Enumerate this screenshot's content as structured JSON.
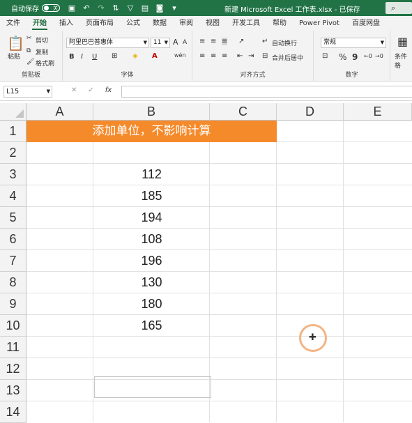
{
  "titlebar": {
    "autosave_label": "自动保存",
    "autosave_state": "关",
    "title": "新建 Microsoft Excel 工作表.xlsx - 已保存",
    "search_icon": "search-icon"
  },
  "menu": {
    "tabs": [
      "文件",
      "开始",
      "插入",
      "页面布局",
      "公式",
      "数据",
      "审阅",
      "视图",
      "开发工具",
      "帮助",
      "Power Pivot",
      "百度网盘"
    ],
    "active": "开始"
  },
  "ribbon": {
    "clipboard": {
      "paste": "粘贴",
      "cut": "剪切",
      "copy": "复制",
      "format_painter": "格式刷",
      "label": "剪贴板"
    },
    "font": {
      "name": "阿里巴巴普惠体",
      "size": "11",
      "bold": "B",
      "italic": "I",
      "underline": "U",
      "label": "字体"
    },
    "align": {
      "wrap": "自动换行",
      "merge": "合并后居中",
      "label": "对齐方式"
    },
    "number": {
      "format": "常规",
      "percent": "%",
      "comma": "9",
      "label": "数字"
    },
    "styles": {
      "conditional": "条件格"
    }
  },
  "formula_bar": {
    "name_box": "L15",
    "cancel": "✕",
    "enter": "✓",
    "fx": "fx",
    "content": ""
  },
  "sheet": {
    "columns": [
      "A",
      "B",
      "C",
      "D",
      "E"
    ],
    "rows": [
      "1",
      "2",
      "3",
      "4",
      "5",
      "6",
      "7",
      "8",
      "9",
      "10",
      "11",
      "12",
      "13",
      "14"
    ],
    "header_text": "添加单位，不影响计算",
    "header_color": "#F58A2B",
    "values": [
      "112",
      "185",
      "194",
      "108",
      "196",
      "130",
      "180",
      "165"
    ]
  }
}
